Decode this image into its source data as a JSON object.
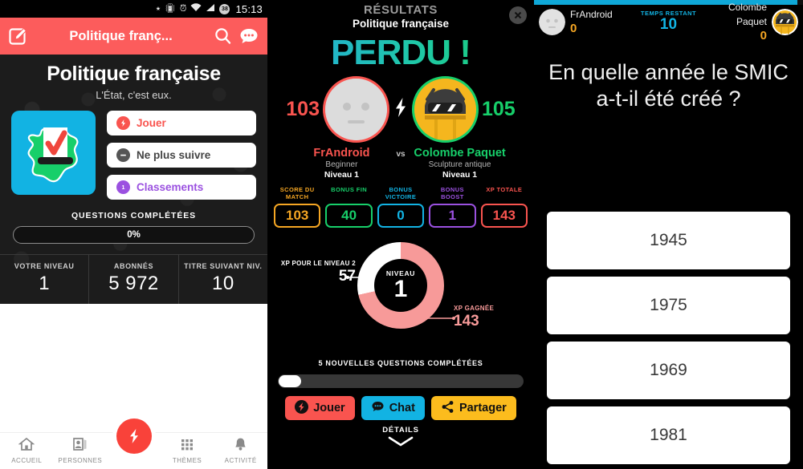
{
  "panel1": {
    "statusbar": {
      "time": "15:13",
      "battery": "38",
      "icons": [
        "bluetooth-icon",
        "vibrate-icon",
        "alarm-icon",
        "wifi-icon",
        "signal-icon"
      ]
    },
    "appbar": {
      "title": "Politique franç...",
      "edit_icon": "edit-icon",
      "search_icon": "search-icon",
      "chat_icon": "chat-icon"
    },
    "hero": {
      "title": "Politique française",
      "subtitle": "L'État, c'est eux.",
      "thumb_icon": "france-ballot-icon"
    },
    "buttons": [
      {
        "label": "Jouer",
        "icon": "bolt-icon",
        "color": "#f9544f"
      },
      {
        "label": "Ne plus suivre",
        "icon": "minus-icon",
        "color": "#555555"
      },
      {
        "label": "Classements",
        "icon": "rosette-icon",
        "color": "#9b51e0"
      }
    ],
    "progress": {
      "title": "QUESTIONS COMPLÉTÉES",
      "value": "0%",
      "percent": 0
    },
    "stats": [
      {
        "label": "VOTRE NIVEAU",
        "value": "1"
      },
      {
        "label": "ABONNÉS",
        "value": "5 972"
      },
      {
        "label": "TITRE SUIVANT NIV.",
        "value": "10"
      }
    ],
    "nav": [
      {
        "label": "ACCUEIL",
        "icon": "home-icon"
      },
      {
        "label": "PERSONNES",
        "icon": "people-icon"
      },
      {
        "label": "",
        "icon": "bolt-fab-icon"
      },
      {
        "label": "THÈMES",
        "icon": "grid-icon"
      },
      {
        "label": "ACTIVITÉ",
        "icon": "bell-icon"
      }
    ]
  },
  "panel2": {
    "header": {
      "label": "RÉSULTATS",
      "subject": "Politique française",
      "close_icon": "close-icon"
    },
    "outcome": "PERDU !",
    "duel": {
      "left": {
        "score": "103",
        "name": "FrAndroid",
        "title": "Beginner",
        "level": "Niveau 1",
        "avatar": "blank-face-avatar",
        "color": "#f9544f"
      },
      "right": {
        "score": "105",
        "name": "Colombe Paquet",
        "title": "Sculpture antique",
        "level": "Niveau 1",
        "avatar": "android-sunglasses-avatar",
        "color": "#17cf6a"
      },
      "vs": "vs",
      "bolt_icon": "bolt-icon"
    },
    "score_boxes": [
      {
        "label": "SCORE DU MATCH",
        "value": "103",
        "color": "#f5a623"
      },
      {
        "label": "BONUS FIN",
        "value": "40",
        "color": "#17cf6a"
      },
      {
        "label": "BONUS VICTOIRE",
        "value": "0",
        "color": "#12b3e3"
      },
      {
        "label": "BONUS BOOST",
        "value": "1",
        "color": "#9b51e0"
      },
      {
        "label": "XP TOTALE",
        "value": "143",
        "color": "#f9544f"
      }
    ],
    "level_ring": {
      "center_label": "NIVEAU",
      "center_value": "1",
      "left_label": "XP POUR LE NIVEAU 2",
      "left_value": "57",
      "right_label": "XP GAGNÉE",
      "right_value": "143",
      "ring_color": "#f79a99",
      "remaining_color": "#ffffff"
    },
    "new_questions": "5 NOUVELLES QUESTIONS COMPLÉTÉES",
    "actions": [
      {
        "label": "Jouer",
        "icon": "bolt-icon",
        "color": "#f9544f"
      },
      {
        "label": "Chat",
        "icon": "chat-icon",
        "color": "#12b3e3"
      },
      {
        "label": "Partager",
        "icon": "share-icon",
        "color": "#fcbc1d"
      }
    ],
    "details": {
      "label": "DÉTAILS",
      "icon": "chevron-down-icon"
    }
  },
  "panel3": {
    "progress_percent": 98,
    "left_player": {
      "name": "FrAndroid",
      "score": "0",
      "avatar": "blank-face-avatar"
    },
    "right_player": {
      "name": "Colombe Paquet",
      "score": "0",
      "avatar": "android-sunglasses-avatar"
    },
    "timer": {
      "label": "TEMPS RESTANT",
      "value": "10"
    },
    "question": "En quelle année le SMIC a-t-il été créé ?",
    "answers": [
      "1945",
      "1975",
      "1969",
      "1981"
    ]
  },
  "chart_data": {
    "type": "pie",
    "title": "NIVEAU 1",
    "categories": [
      "XP GAGNÉE",
      "XP POUR LE NIVEAU 2"
    ],
    "values": [
      143,
      57
    ],
    "colors": [
      "#f79a99",
      "#ffffff"
    ],
    "legend": "annotations"
  }
}
